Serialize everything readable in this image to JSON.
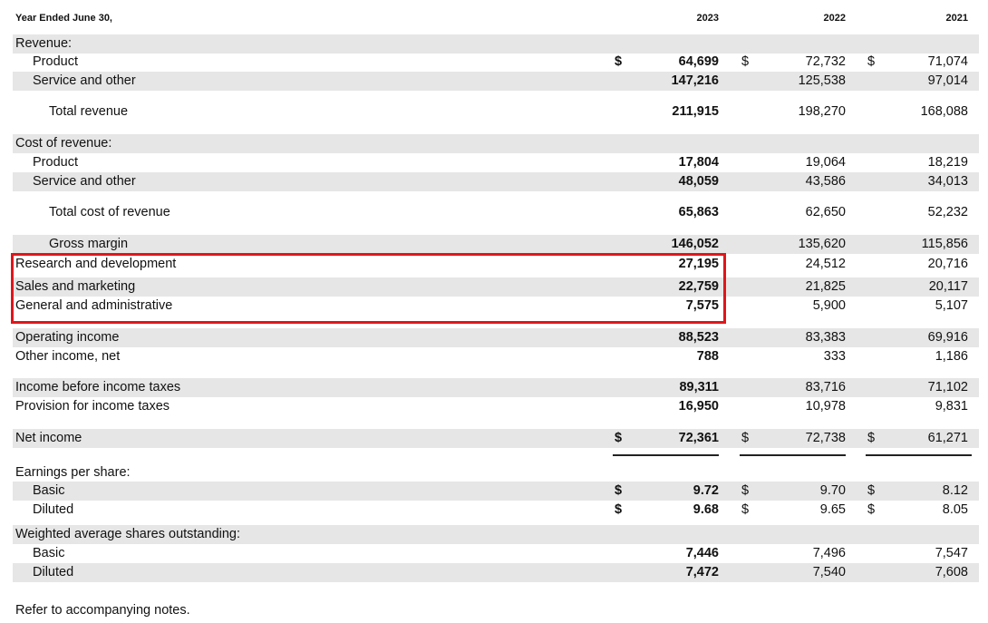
{
  "header": {
    "period_label": "Year Ended June 30,",
    "years": [
      "2023",
      "2022",
      "2021"
    ]
  },
  "currency_symbol": "$",
  "rows": [
    {
      "label": "Revenue:",
      "indent": 0
    },
    {
      "label": "Product",
      "indent": 1,
      "v2023": "64,699",
      "v2022": "72,732",
      "v2021": "71,074",
      "dollar": true
    },
    {
      "label": "Service and other",
      "indent": 1,
      "v2023": "147,216",
      "v2022": "125,538",
      "v2021": "97,014"
    },
    {
      "label": "Total revenue",
      "indent": 2,
      "v2023": "211,915",
      "v2022": "198,270",
      "v2021": "168,088"
    },
    {
      "label": "Cost of revenue:",
      "indent": 0
    },
    {
      "label": "Product",
      "indent": 1,
      "v2023": "17,804",
      "v2022": "19,064",
      "v2021": "18,219"
    },
    {
      "label": "Service and other",
      "indent": 1,
      "v2023": "48,059",
      "v2022": "43,586",
      "v2021": "34,013"
    },
    {
      "label": "Total cost of revenue",
      "indent": 2,
      "v2023": "65,863",
      "v2022": "62,650",
      "v2021": "52,232"
    },
    {
      "label": "Gross margin",
      "indent": 2,
      "v2023": "146,052",
      "v2022": "135,620",
      "v2021": "115,856"
    },
    {
      "label": "Research and development",
      "indent": 0,
      "v2023": "27,195",
      "v2022": "24,512",
      "v2021": "20,716"
    },
    {
      "label": "Sales and marketing",
      "indent": 0,
      "v2023": "22,759",
      "v2022": "21,825",
      "v2021": "20,117"
    },
    {
      "label": "General and administrative",
      "indent": 0,
      "v2023": "7,575",
      "v2022": "5,900",
      "v2021": "5,107"
    },
    {
      "label": "Operating income",
      "indent": 0,
      "v2023": "88,523",
      "v2022": "83,383",
      "v2021": "69,916"
    },
    {
      "label": "Other income, net",
      "indent": 0,
      "v2023": "788",
      "v2022": "333",
      "v2021": "1,186"
    },
    {
      "label": "Income before income taxes",
      "indent": 0,
      "v2023": "89,311",
      "v2022": "83,716",
      "v2021": "71,102"
    },
    {
      "label": "Provision for income taxes",
      "indent": 0,
      "v2023": "16,950",
      "v2022": "10,978",
      "v2021": "9,831"
    },
    {
      "label": "Net income",
      "indent": 0,
      "v2023": "72,361",
      "v2022": "72,738",
      "v2021": "61,271",
      "dollar": true
    },
    {
      "label": "Earnings per share:",
      "indent": 0
    },
    {
      "label": "Basic",
      "indent": 1,
      "v2023": "9.72",
      "v2022": "9.70",
      "v2021": "8.12",
      "dollar": true
    },
    {
      "label": "Diluted",
      "indent": 1,
      "v2023": "9.68",
      "v2022": "9.65",
      "v2021": "8.05",
      "dollar": true
    },
    {
      "label": "Weighted average shares outstanding:",
      "indent": 0
    },
    {
      "label": "Basic",
      "indent": 1,
      "v2023": "7,446",
      "v2022": "7,496",
      "v2021": "7,547"
    },
    {
      "label": "Diluted",
      "indent": 1,
      "v2023": "7,472",
      "v2022": "7,540",
      "v2021": "7,608"
    }
  ],
  "footnote": "Refer to accompanying notes.",
  "colors": {
    "shade": "#e6e6e6",
    "highlight_border": "#e0161b"
  }
}
